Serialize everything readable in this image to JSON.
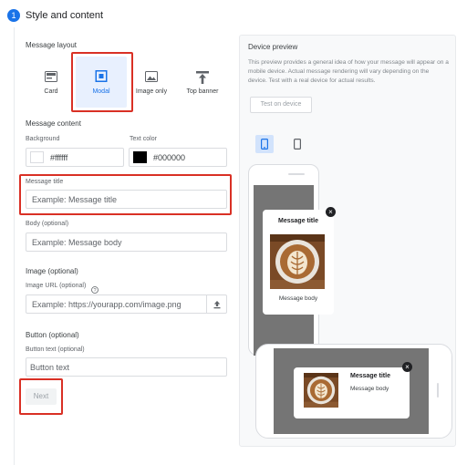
{
  "header": {
    "step_number": "1",
    "title": "Style and content"
  },
  "layout": {
    "section_label": "Message layout",
    "options": [
      {
        "label": "Card",
        "icon": "card-icon",
        "selected": false
      },
      {
        "label": "Modal",
        "icon": "modal-icon",
        "selected": true
      },
      {
        "label": "Image only",
        "icon": "image-icon",
        "selected": false
      },
      {
        "label": "Top banner",
        "icon": "top-banner-icon",
        "selected": false
      }
    ]
  },
  "content": {
    "section_label": "Message content",
    "background_label": "Background",
    "background_value": "#ffffff",
    "text_color_label": "Text color",
    "text_color_value": "#000000",
    "title_label": "Message title",
    "title_placeholder": "Example: Message title",
    "body_label": "Body (optional)",
    "body_placeholder": "Example: Message body"
  },
  "image": {
    "section_label": "Image (optional)",
    "url_label": "Image URL (optional)",
    "url_placeholder": "Example: https://yourapp.com/image.png"
  },
  "button": {
    "section_label": "Button (optional)",
    "text_label": "Button text (optional)",
    "text_placeholder": "Button text"
  },
  "next_label": "Next",
  "preview": {
    "title": "Device preview",
    "description": "This preview provides a general idea of how your message will appear on a mobile device. Actual message rendering will vary depending on the device. Test with a real device for actual results.",
    "test_button": "Test on device",
    "modal_title": "Message title",
    "modal_body": "Message body",
    "close_glyph": "×"
  },
  "colors": {
    "accent": "#1a73e8",
    "highlight_border": "#d93025",
    "preview_screen": "#757575"
  }
}
